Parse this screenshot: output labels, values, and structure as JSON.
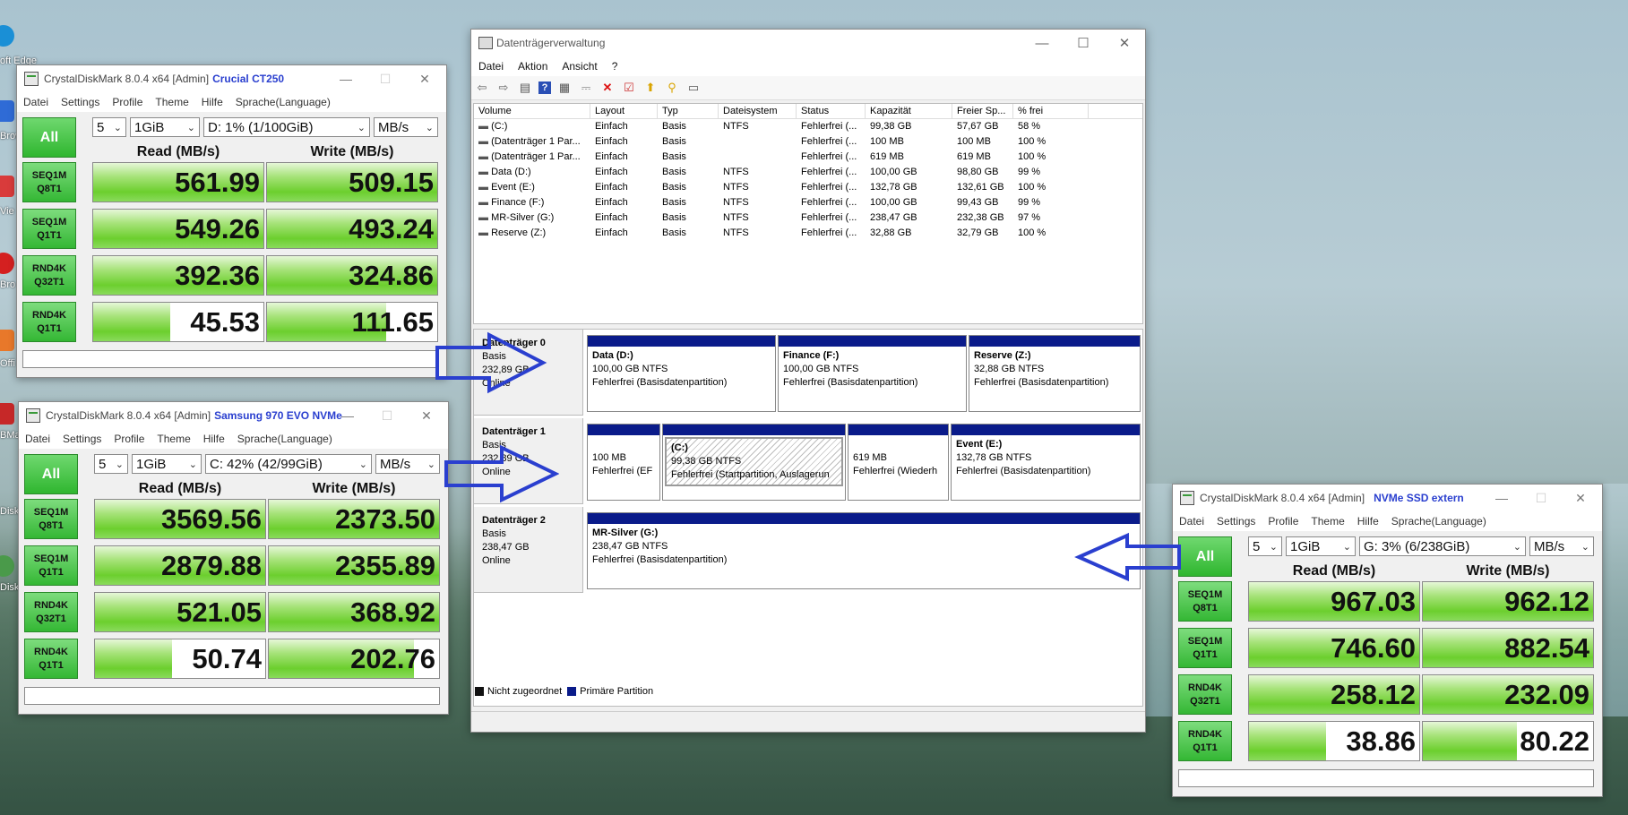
{
  "colors": {
    "accent_blue": "#2a3fcf",
    "partition_header": "#0a1b8a",
    "bar_green": "#6ccf2e"
  },
  "desktop": {
    "labels": [
      "oft Edge",
      "Browse",
      "Vie",
      "Bro",
      "Offi",
      "BMa",
      "Disk",
      "Disk"
    ]
  },
  "cdm_windows": [
    {
      "title": "CrystalDiskMark 8.0.4 x64 [Admin]",
      "drive_label": "Crucial CT250",
      "menu": [
        "Datei",
        "Settings",
        "Profile",
        "Theme",
        "Hilfe",
        "Sprache(Language)"
      ],
      "all_label": "All",
      "count": "5",
      "size": "1GiB",
      "drive": "D: 1% (1/100GiB)",
      "unit": "MB/s",
      "read_header": "Read (MB/s)",
      "write_header": "Write (MB/s)",
      "rows": [
        {
          "line1": "SEQ1M",
          "line2": "Q8T1",
          "read": "561.99",
          "write": "509.15",
          "read_fill": 1.0,
          "write_fill": 1.0
        },
        {
          "line1": "SEQ1M",
          "line2": "Q1T1",
          "read": "549.26",
          "write": "493.24",
          "read_fill": 1.0,
          "write_fill": 1.0
        },
        {
          "line1": "RND4K",
          "line2": "Q32T1",
          "read": "392.36",
          "write": "324.86",
          "read_fill": 1.0,
          "write_fill": 1.0
        },
        {
          "line1": "RND4K",
          "line2": "Q1T1",
          "read": "45.53",
          "write": "111.65",
          "read_fill": 0.45,
          "write_fill": 0.7
        }
      ]
    },
    {
      "title": "CrystalDiskMark 8.0.4 x64 [Admin]",
      "drive_label": "Samsung 970 EVO NVMe",
      "menu": [
        "Datei",
        "Settings",
        "Profile",
        "Theme",
        "Hilfe",
        "Sprache(Language)"
      ],
      "all_label": "All",
      "count": "5",
      "size": "1GiB",
      "drive": "C: 42% (42/99GiB)",
      "unit": "MB/s",
      "read_header": "Read (MB/s)",
      "write_header": "Write (MB/s)",
      "rows": [
        {
          "line1": "SEQ1M",
          "line2": "Q8T1",
          "read": "3569.56",
          "write": "2373.50",
          "read_fill": 1.0,
          "write_fill": 1.0
        },
        {
          "line1": "SEQ1M",
          "line2": "Q1T1",
          "read": "2879.88",
          "write": "2355.89",
          "read_fill": 1.0,
          "write_fill": 1.0
        },
        {
          "line1": "RND4K",
          "line2": "Q32T1",
          "read": "521.05",
          "write": "368.92",
          "read_fill": 1.0,
          "write_fill": 1.0
        },
        {
          "line1": "RND4K",
          "line2": "Q1T1",
          "read": "50.74",
          "write": "202.76",
          "read_fill": 0.45,
          "write_fill": 0.85
        }
      ]
    },
    {
      "title": "CrystalDiskMark 8.0.4 x64 [Admin]",
      "drive_label": "NVMe SSD extern",
      "menu": [
        "Datei",
        "Settings",
        "Profile",
        "Theme",
        "Hilfe",
        "Sprache(Language)"
      ],
      "all_label": "All",
      "count": "5",
      "size": "1GiB",
      "drive": "G: 3% (6/238GiB)",
      "unit": "MB/s",
      "read_header": "Read (MB/s)",
      "write_header": "Write (MB/s)",
      "rows": [
        {
          "line1": "SEQ1M",
          "line2": "Q8T1",
          "read": "967.03",
          "write": "962.12",
          "read_fill": 1.0,
          "write_fill": 1.0
        },
        {
          "line1": "SEQ1M",
          "line2": "Q1T1",
          "read": "746.60",
          "write": "882.54",
          "read_fill": 1.0,
          "write_fill": 1.0
        },
        {
          "line1": "RND4K",
          "line2": "Q32T1",
          "read": "258.12",
          "write": "232.09",
          "read_fill": 1.0,
          "write_fill": 1.0
        },
        {
          "line1": "RND4K",
          "line2": "Q1T1",
          "read": "38.86",
          "write": "80.22",
          "read_fill": 0.45,
          "write_fill": 0.55
        }
      ]
    }
  ],
  "disk_mgmt": {
    "title": "Datenträgerverwaltung",
    "menu": [
      "Datei",
      "Aktion",
      "Ansicht",
      "?"
    ],
    "toolbar_icons": [
      "back-icon",
      "forward-icon",
      "list-view-icon",
      "help-icon",
      "properties-icon",
      "connect-icon",
      "delete-icon",
      "check-icon",
      "export-icon",
      "search-icon",
      "details-icon"
    ],
    "columns": [
      "Volume",
      "Layout",
      "Typ",
      "Dateisystem",
      "Status",
      "Kapazität",
      "Freier Sp...",
      "% frei"
    ],
    "volumes": [
      [
        "(C:)",
        "Einfach",
        "Basis",
        "NTFS",
        "Fehlerfrei (...",
        "99,38 GB",
        "57,67 GB",
        "58 %"
      ],
      [
        "(Datenträger 1 Par...",
        "Einfach",
        "Basis",
        "",
        "Fehlerfrei (...",
        "100 MB",
        "100 MB",
        "100 %"
      ],
      [
        "(Datenträger 1 Par...",
        "Einfach",
        "Basis",
        "",
        "Fehlerfrei (...",
        "619 MB",
        "619 MB",
        "100 %"
      ],
      [
        "Data (D:)",
        "Einfach",
        "Basis",
        "NTFS",
        "Fehlerfrei (...",
        "100,00 GB",
        "98,80 GB",
        "99 %"
      ],
      [
        "Event (E:)",
        "Einfach",
        "Basis",
        "NTFS",
        "Fehlerfrei (...",
        "132,78 GB",
        "132,61 GB",
        "100 %"
      ],
      [
        "Finance (F:)",
        "Einfach",
        "Basis",
        "NTFS",
        "Fehlerfrei (...",
        "100,00 GB",
        "99,43 GB",
        "99 %"
      ],
      [
        "MR-Silver (G:)",
        "Einfach",
        "Basis",
        "NTFS",
        "Fehlerfrei (...",
        "238,47 GB",
        "232,38 GB",
        "97 %"
      ],
      [
        "Reserve (Z:)",
        "Einfach",
        "Basis",
        "NTFS",
        "Fehlerfrei (...",
        "32,88 GB",
        "32,79 GB",
        "100 %"
      ]
    ],
    "disks": [
      {
        "name": "Datenträger 0",
        "type": "Basis",
        "size": "232,89 GB",
        "state": "Online",
        "partitions": [
          {
            "name": "Data  (D:)",
            "size": "100,00 GB NTFS",
            "status": "Fehlerfrei (Basisdatenpartition)"
          },
          {
            "name": "Finance  (F:)",
            "size": "100,00 GB NTFS",
            "status": "Fehlerfrei (Basisdatenpartition)"
          },
          {
            "name": "Reserve  (Z:)",
            "size": "32,88 GB NTFS",
            "status": "Fehlerfrei (Basisdatenpartition)"
          }
        ]
      },
      {
        "name": "Datenträger 1",
        "type": "Basis",
        "size": "232,89 GB",
        "state": "Online",
        "partitions": [
          {
            "name": "",
            "size": "100 MB",
            "status": "Fehlerfrei (EF"
          },
          {
            "name": "(C:)",
            "size": "99,38 GB NTFS",
            "status": "Fehlerfrei (Startpartition, Auslagerun"
          },
          {
            "name": "",
            "size": "619 MB",
            "status": "Fehlerfrei (Wiederh"
          },
          {
            "name": "Event  (E:)",
            "size": "132,78 GB NTFS",
            "status": "Fehlerfrei (Basisdatenpartition)"
          }
        ]
      },
      {
        "name": "Datenträger 2",
        "type": "Basis",
        "size": "238,47 GB",
        "state": "Online",
        "partitions": [
          {
            "name": "MR-Silver  (G:)",
            "size": "238,47 GB NTFS",
            "status": "Fehlerfrei (Basisdatenpartition)"
          }
        ]
      }
    ],
    "legend": {
      "unallocated": "Nicht zugeordnet",
      "primary": "Primäre Partition"
    }
  }
}
